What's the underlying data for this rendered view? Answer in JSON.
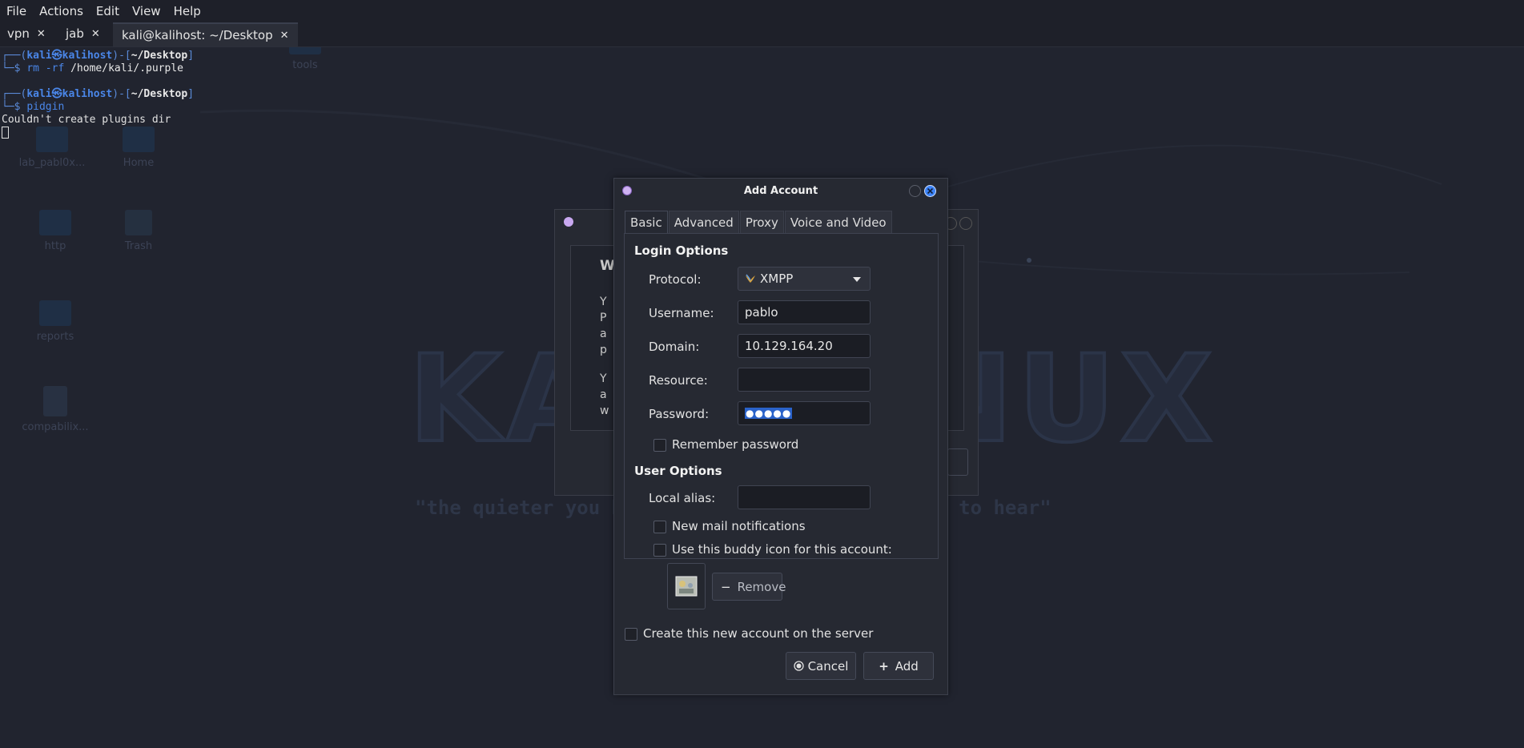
{
  "menubar": {
    "items": [
      "File",
      "Actions",
      "Edit",
      "View",
      "Help"
    ]
  },
  "tabs": [
    {
      "label": "vpn",
      "close": "✕"
    },
    {
      "label": "jab",
      "close": "✕"
    },
    {
      "label": "kali@kalihost: ~/Desktop",
      "close": "✕"
    }
  ],
  "terminal": {
    "user": "kali",
    "at": "㉿",
    "host": "kalihost",
    "dir": "~/Desktop",
    "cmd1": "rm",
    "cmd1_args": " -rf ",
    "cmd1_path": "/home/kali/.purple",
    "cmd2": "pidgin",
    "output": "Couldn't create plugins dir"
  },
  "desktop": {
    "icons": [
      "tools",
      "lab_pabl0x...",
      "Home",
      "http",
      "Trash",
      "reports",
      "compabilix..."
    ],
    "wallpaper_word": "KALI LINUX",
    "wallpaper_tagline": "\"the quieter you become, the more you are able to hear\""
  },
  "behind_window": {
    "letters": [
      "W",
      "Y",
      "P",
      "a",
      "p",
      "Y",
      "a",
      "w"
    ]
  },
  "dialog": {
    "title": "Add Account",
    "tabs": [
      "Basic",
      "Advanced",
      "Proxy",
      "Voice and Video"
    ],
    "login_options": "Login Options",
    "protocol_label": "Protocol:",
    "protocol_value": "XMPP",
    "username_label": "Username:",
    "username_value": "pablo",
    "domain_label": "Domain:",
    "domain_value": "10.129.164.20",
    "resource_label": "Resource:",
    "resource_value": "",
    "password_label": "Password:",
    "password_value": "●●●●●",
    "remember_password": "Remember password",
    "user_options": "User Options",
    "local_alias_label": "Local alias:",
    "local_alias_value": "",
    "new_mail": "New mail notifications",
    "buddy_icon": "Use this buddy icon for this account:",
    "remove_button": "Remove",
    "create_account": "Create this new account on the server",
    "cancel_button": "Cancel",
    "add_button": "Add"
  },
  "colors": {
    "accent": "#3a7be0",
    "selection": "#2a62c9",
    "close_button": "#3b82f6"
  }
}
